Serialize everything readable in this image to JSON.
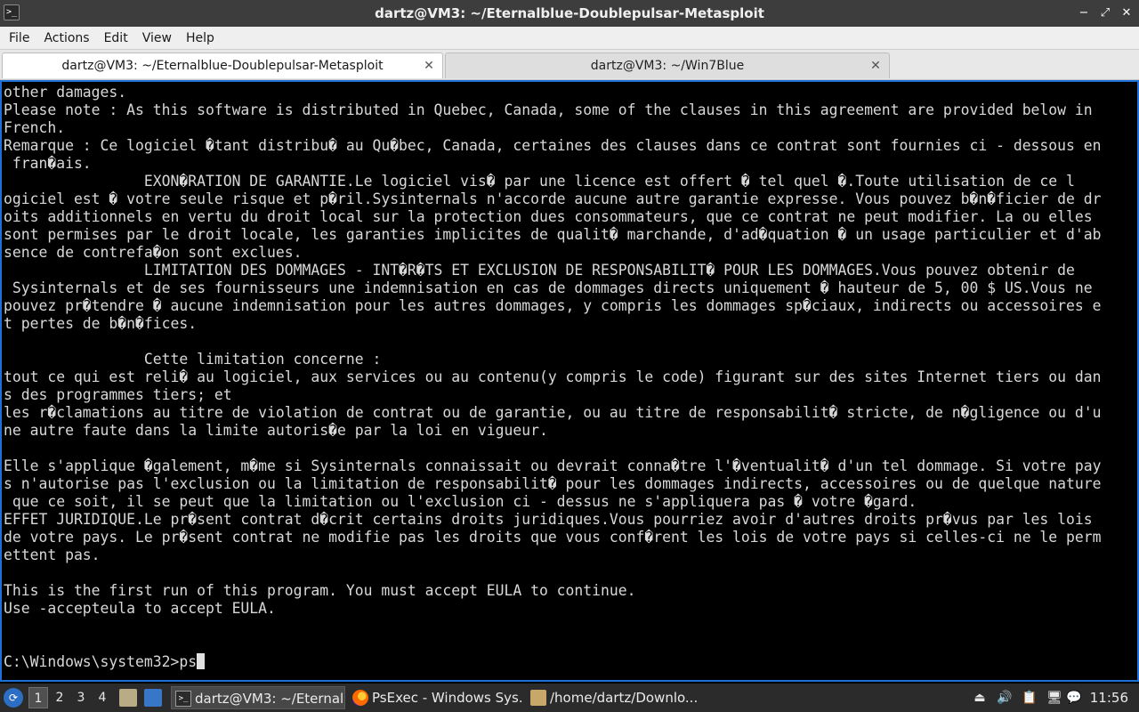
{
  "window": {
    "title": "dartz@VM3: ~/Eternalblue-Doublepulsar-Metasploit",
    "icon": "terminal-icon"
  },
  "menu": [
    "File",
    "Actions",
    "Edit",
    "View",
    "Help"
  ],
  "tabs": [
    {
      "label": "dartz@VM3: ~/Eternalblue-Doublepulsar-Metasploit",
      "active": true
    },
    {
      "label": "dartz@VM3: ~/Win7Blue",
      "active": false
    }
  ],
  "terminal": {
    "lines": [
      "other damages.",
      "Please note : As this software is distributed in Quebec, Canada, some of the clauses in this agreement are provided below in",
      "French.",
      "Remarque : Ce logiciel �tant distribu� au Qu�bec, Canada, certaines des clauses dans ce contrat sont fournies ci - dessous en",
      " fran�ais.",
      "                EXON�RATION DE GARANTIE.Le logiciel vis� par une licence est offert � tel quel �.Toute utilisation de ce l",
      "ogiciel est � votre seule risque et p�ril.Sysinternals n'accorde aucune autre garantie expresse. Vous pouvez b�n�ficier de dr",
      "oits additionnels en vertu du droit local sur la protection dues consommateurs, que ce contrat ne peut modifier. La ou elles",
      "sont permises par le droit locale, les garanties implicites de qualit� marchande, d'ad�quation � un usage particulier et d'ab",
      "sence de contrefa�on sont exclues.",
      "                LIMITATION DES DOMMAGES - INT�R�TS ET EXCLUSION DE RESPONSABILIT� POUR LES DOMMAGES.Vous pouvez obtenir de",
      " Sysinternals et de ses fournisseurs une indemnisation en cas de dommages directs uniquement � hauteur de 5, 00 $ US.Vous ne",
      "pouvez pr�tendre � aucune indemnisation pour les autres dommages, y compris les dommages sp�ciaux, indirects ou accessoires e",
      "t pertes de b�n�fices.",
      "",
      "                Cette limitation concerne :",
      "tout ce qui est reli� au logiciel, aux services ou au contenu(y compris le code) figurant sur des sites Internet tiers ou dan",
      "s des programmes tiers; et",
      "les r�clamations au titre de violation de contrat ou de garantie, ou au titre de responsabilit� stricte, de n�gligence ou d'u",
      "ne autre faute dans la limite autoris�e par la loi en vigueur.",
      "",
      "Elle s'applique �galement, m�me si Sysinternals connaissait ou devrait conna�tre l'�ventualit� d'un tel dommage. Si votre pay",
      "s n'autorise pas l'exclusion ou la limitation de responsabilit� pour les dommages indirects, accessoires ou de quelque nature",
      " que ce soit, il se peut que la limitation ou l'exclusion ci - dessus ne s'appliquera pas � votre �gard.",
      "EFFET JURIDIQUE.Le pr�sent contrat d�crit certains droits juridiques.Vous pourriez avoir d'autres droits pr�vus par les lois",
      "de votre pays. Le pr�sent contrat ne modifie pas les droits que vous conf�rent les lois de votre pays si celles-ci ne le perm",
      "ettent pas.",
      "",
      "This is the first run of this program. You must accept EULA to continue.",
      "Use -accepteula to accept EULA.",
      "",
      ""
    ],
    "prompt": "C:\\Windows\\system32>ps"
  },
  "taskbar": {
    "workspaces": [
      "1",
      "2",
      "3",
      "4"
    ],
    "tasks": [
      {
        "label": "dartz@VM3: ~/Eternal...",
        "icon": "terminal-icon",
        "active": true
      },
      {
        "label": "PsExec - Windows Sys...",
        "icon": "firefox-icon",
        "active": false
      },
      {
        "label": "/home/dartz/Downlo...",
        "icon": "folder-icon",
        "active": false
      }
    ],
    "clock": "11:56"
  }
}
